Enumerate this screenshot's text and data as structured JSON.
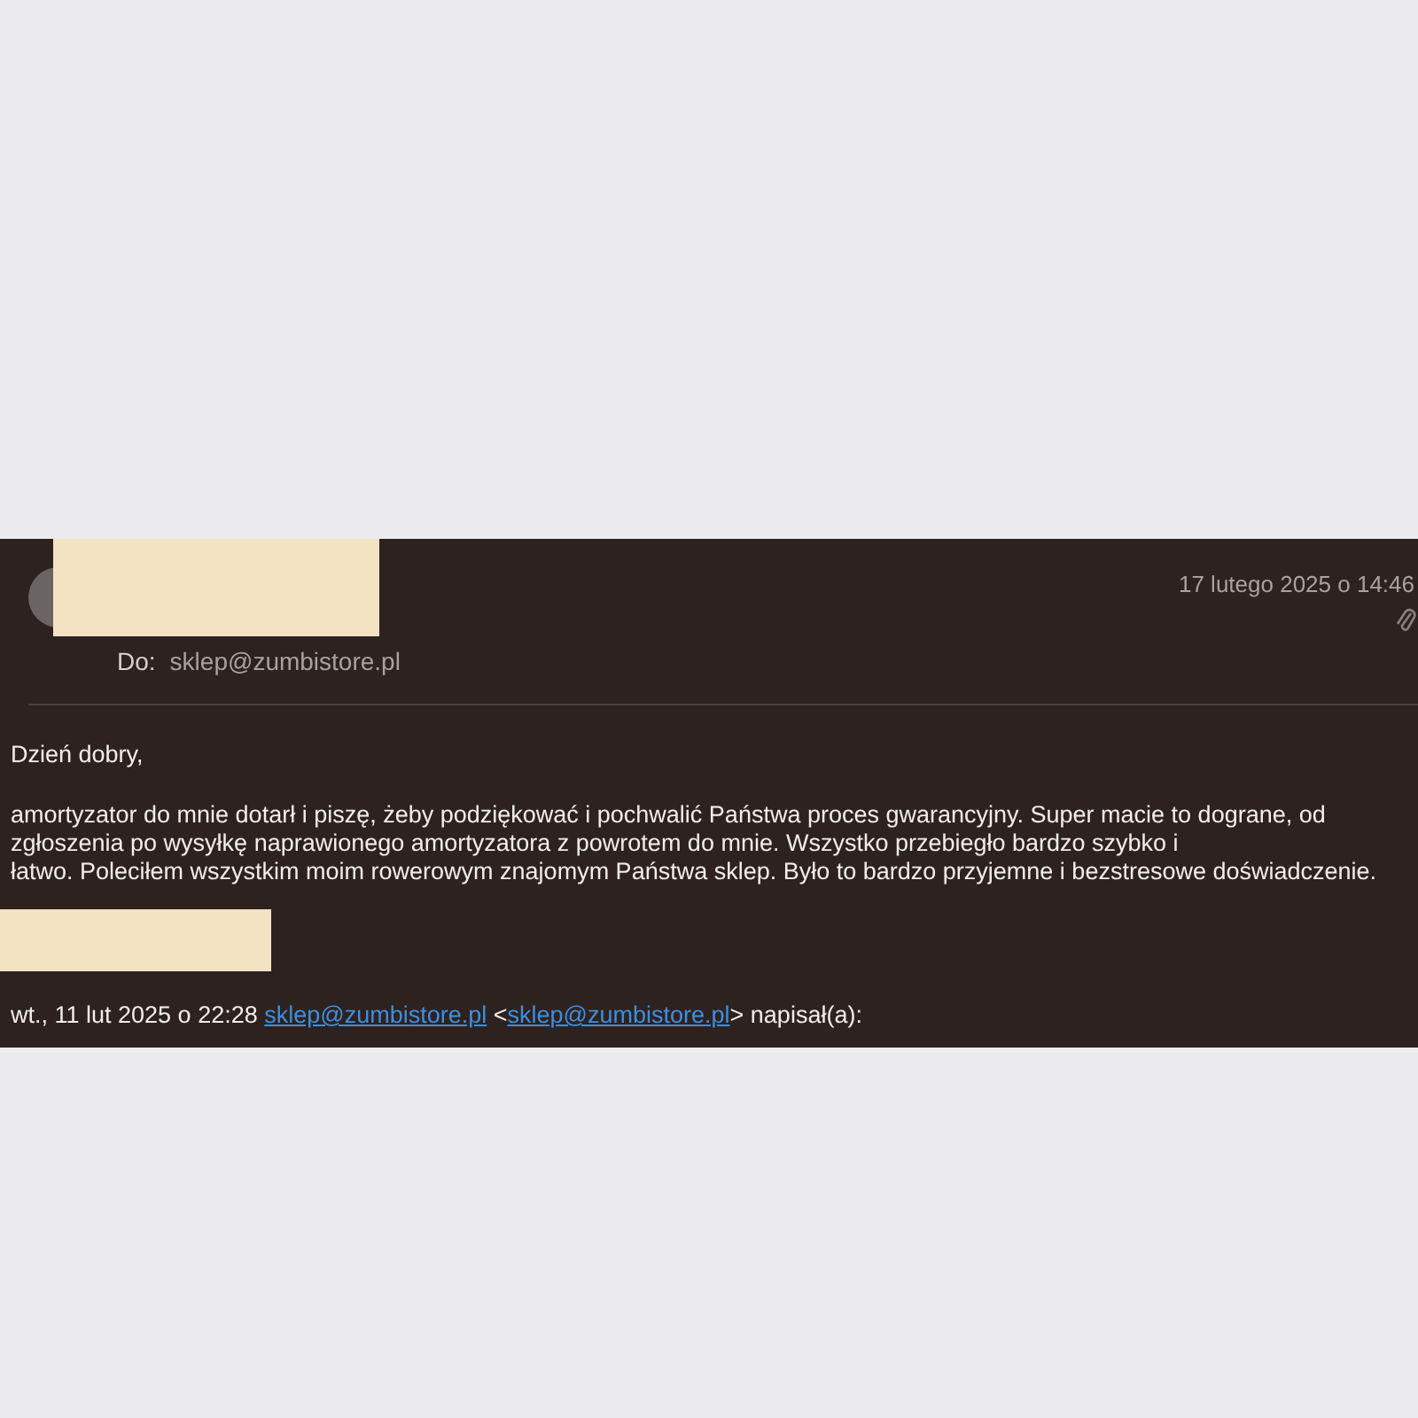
{
  "message": {
    "date": "17 lutego 2025 o 14:46",
    "to_label": "Do:",
    "to_address": "sklep@zumbistore.pl",
    "has_attachment": true,
    "greeting": "Dzień dobry,",
    "body_lines": [
      "amortyzator do mnie dotarł i piszę, żeby podziękować i pochwalić Państwa proces gwarancyjny. Super macie to dograne, od",
      "zgłoszenia po wysyłkę naprawionego amortyzatora z powrotem do mnie. Wszystko przebiegło bardzo szybko i",
      "łatwo. Poleciłem wszystkim moim rowerowym znajomym Państwa sklep. Było to bardzo przyjemne i bezstresowe doświadczenie."
    ],
    "quote": {
      "prefix": "wt., 11 lut 2025 o 22:28",
      "link": "sklep@zumbistore.pl",
      "open": "<",
      "link2": "sklep@zumbistore.pl",
      "suffix": "> napisał(a):"
    }
  }
}
